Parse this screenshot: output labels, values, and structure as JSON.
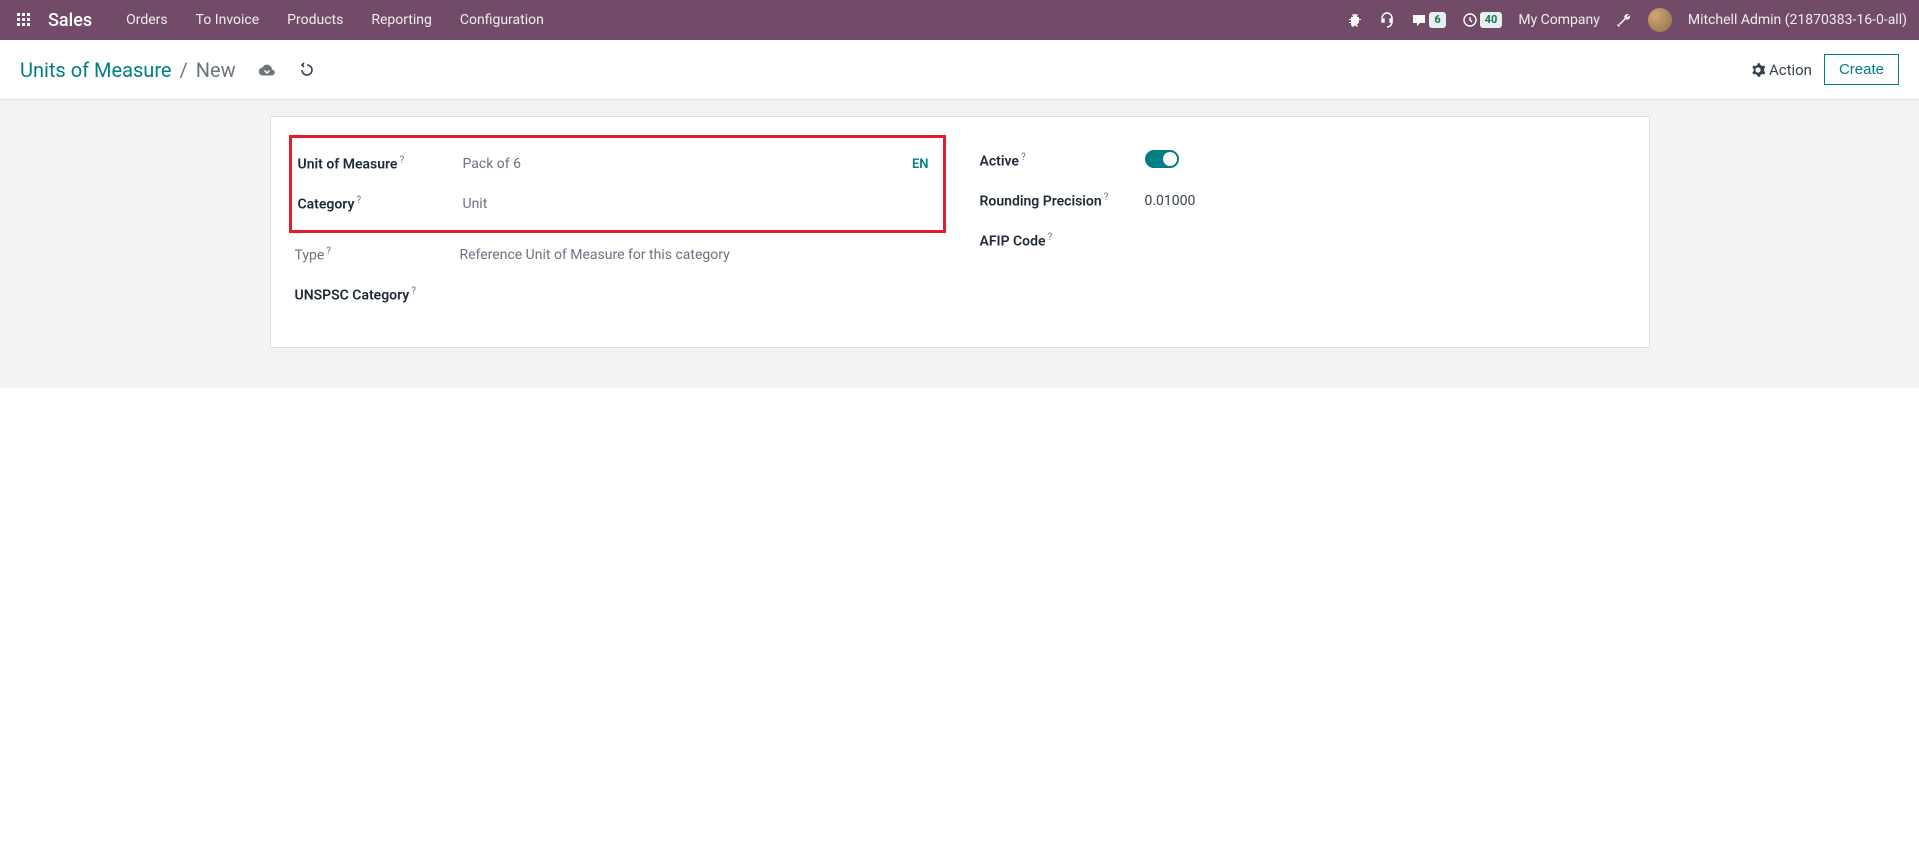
{
  "navbar": {
    "brand": "Sales",
    "menu": [
      "Orders",
      "To Invoice",
      "Products",
      "Reporting",
      "Configuration"
    ],
    "messages_count": "6",
    "activities_count": "40",
    "company": "My Company",
    "user": "Mitchell Admin (21870383-16-0-all)"
  },
  "control_panel": {
    "breadcrumb_parent": "Units of Measure",
    "breadcrumb_current": "New",
    "action_label": "Action",
    "create_label": "Create"
  },
  "form": {
    "left": {
      "uom_label": "Unit of Measure",
      "uom_value": "Pack of 6",
      "category_label": "Category",
      "category_value": "Unit",
      "type_label": "Type",
      "type_value": "Reference Unit of Measure for this category",
      "unspsc_label": "UNSPSC Category",
      "lang": "EN"
    },
    "right": {
      "active_label": "Active",
      "active_value": true,
      "rounding_label": "Rounding Precision",
      "rounding_value": "0.01000",
      "afip_label": "AFIP Code"
    }
  }
}
